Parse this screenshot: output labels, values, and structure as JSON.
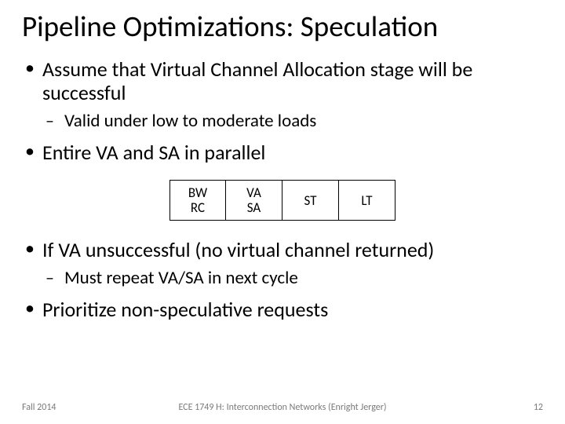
{
  "title": "Pipeline Optimizations: Speculation",
  "bullets": {
    "b0": "Assume that Virtual Channel Allocation stage will be successful",
    "b0_sub0": "Valid under low to moderate loads",
    "b1": "Entire VA and SA in parallel",
    "b2": "If VA unsuccessful (no virtual channel returned)",
    "b2_sub0": "Must repeat VA/SA in next cycle",
    "b3": "Prioritize non-speculative requests"
  },
  "stages": {
    "s0a": "BW",
    "s0b": "RC",
    "s1a": "VA",
    "s1b": "SA",
    "s2": "ST",
    "s3": "LT"
  },
  "footer": {
    "left": "Fall 2014",
    "center": "ECE 1749 H: Interconnection Networks (Enright Jerger)",
    "page": "12"
  }
}
